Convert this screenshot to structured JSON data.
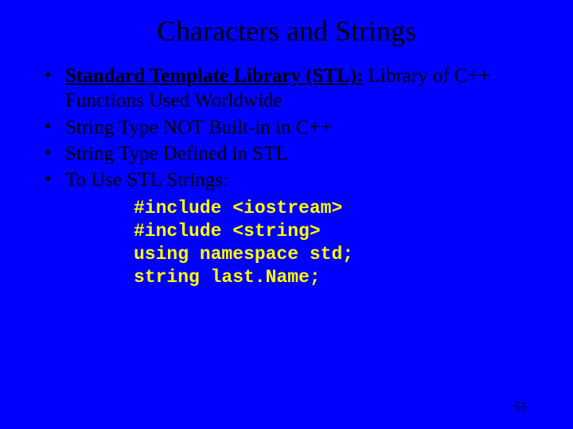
{
  "slide": {
    "title": "Characters and Strings",
    "bullets": [
      {
        "bold_prefix": "Standard Template Library (STL):",
        "rest": " Library of C++ Functions Used Worldwide"
      },
      {
        "text": "String Type NOT Built-in in C++"
      },
      {
        "text": "String Type Defined in STL"
      },
      {
        "text": "To Use STL Strings:"
      }
    ],
    "code": {
      "line1": "#include <iostream>",
      "line2": "#include <string>",
      "line3": "using namespace std;",
      "line4": "string last.Name;"
    },
    "page_number": "65"
  }
}
